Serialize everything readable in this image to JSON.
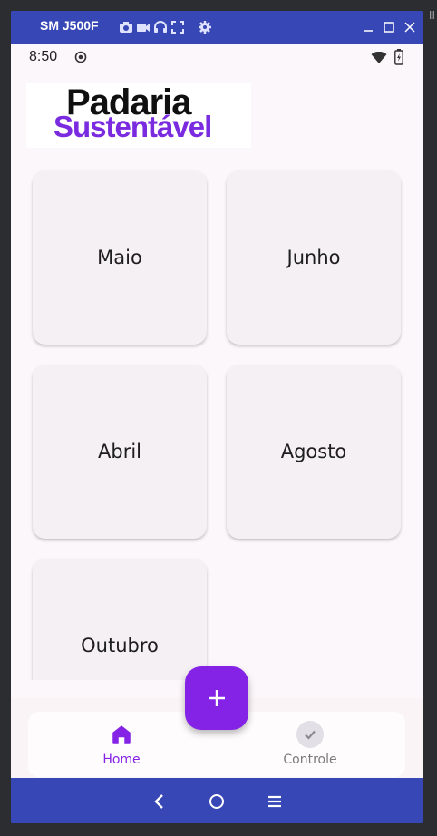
{
  "window": {
    "device_title": "SM J500F",
    "desktop_corner_text": "II"
  },
  "status_bar": {
    "time": "8:50"
  },
  "logo": {
    "line1": "Padaria",
    "line2": "Sustentável"
  },
  "cards": [
    {
      "label": "Maio"
    },
    {
      "label": "Junho"
    },
    {
      "label": "Abril"
    },
    {
      "label": "Agosto"
    },
    {
      "label": "Outubro"
    }
  ],
  "fab": {
    "icon": "plus-icon"
  },
  "bottom_nav": {
    "items": [
      {
        "label": "Home",
        "icon": "home-icon",
        "selected": true
      },
      {
        "label": "Controle",
        "icon": "check-circle-icon",
        "selected": false
      }
    ]
  },
  "colors": {
    "primary": "#8422E6",
    "emulator_chrome": "#3748B6",
    "screen_background": "#FCF7FB",
    "card_background": "#F4F0F4",
    "unselected_nav": "#7A7A7A"
  }
}
